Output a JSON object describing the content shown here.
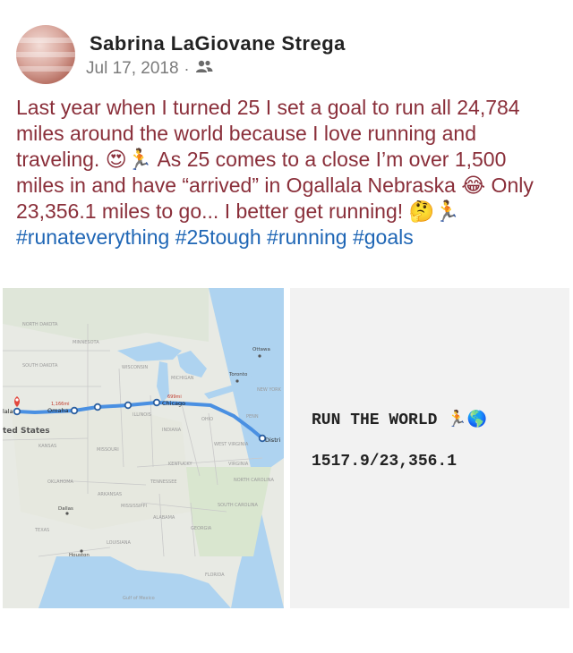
{
  "post": {
    "author": "Sabrina LaGiovane Strega",
    "date": "Jul 17, 2018",
    "separator": "·",
    "audience_icon": "friends-icon",
    "text_parts": {
      "p1": "Last year when I turned 25 I set a goal to run all 24,784 miles around the world because I love running and traveling. ",
      "e1": "😍🏃",
      "p2": " As 25 comes to a close I’m over 1,500 miles in and have “arrived” in Ogallala Nebraska ",
      "e2": "😂",
      "p3": " Only 23,356.1 miles to go... I better get running! ",
      "e3": "🤔🏃",
      "hashtags": "#runateverything #25tough #running #goals"
    }
  },
  "map": {
    "route_color": "#4a90e2",
    "labels": {
      "north_dakota": "NORTH DAKOTA",
      "minnesota": "MINNESOTA",
      "south_dakota": "SOUTH DAKOTA",
      "wisconsin": "WISCONSIN",
      "michigan": "MICHIGAN",
      "ottawa": "Ottawa",
      "toronto": "Toronto",
      "new_york": "NEW YORK",
      "ogallala": "lala",
      "omaha_miles": "1,166mi",
      "omaha": "Omaha",
      "chicago_miles": "699mi",
      "chicago": "Chicago",
      "united_states": "ted States",
      "illinois": "ILLINOIS",
      "indiana": "INDIANA",
      "ohio": "OHIO",
      "penn": "PENN",
      "district": "Distri",
      "kansas": "KANSAS",
      "missouri": "MISSOURI",
      "west_virginia": "WEST VIRGINIA",
      "kentucky": "KENTUCKY",
      "virginia": "VIRGINIA",
      "oklahoma": "OKLAHOMA",
      "tennessee": "TENNESSEE",
      "north_carolina": "NORTH CAROLINA",
      "arkansas": "ARKANSAS",
      "dallas": "Dallas",
      "mississippi": "MISSISSIPPI",
      "south_carolina": "SOUTH CAROLINA",
      "alabama": "ALABAMA",
      "georgia": "GEORGIA",
      "texas": "TEXAS",
      "louisiana": "LOUISIANA",
      "houston": "Houston",
      "florida": "FLORIDA",
      "gulf": "Gulf of Mexico"
    }
  },
  "card": {
    "title": "RUN THE WORLD",
    "title_emoji": "🏃🌎",
    "progress": "1517.9/23,356.1"
  }
}
